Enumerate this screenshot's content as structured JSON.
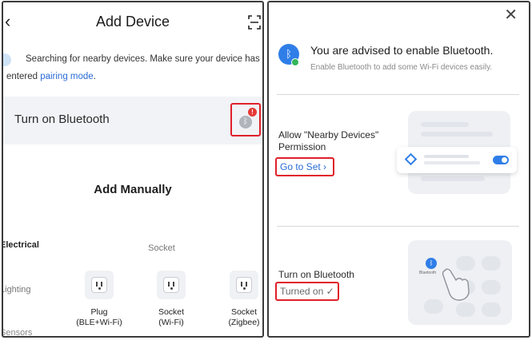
{
  "left": {
    "header": {
      "back_icon": "chevron-left-icon",
      "title": "Add Device",
      "scan_icon": "scan-frame-icon"
    },
    "search": {
      "text_before": "Searching for nearby devices. Make sure your device has entered ",
      "link": "pairing mode",
      "text_after": "."
    },
    "bluetooth_row": {
      "label": "Turn on Bluetooth",
      "icon": "bluetooth-icon",
      "alert": "!",
      "alert_color": "#e53935"
    },
    "manual_title": "Add Manually",
    "categories": [
      "Electrical",
      "Lighting",
      "Sensors"
    ],
    "section_title": "Socket",
    "devices": [
      {
        "line1": "Plug",
        "line2": "(BLE+Wi-Fi)"
      },
      {
        "line1": "Socket",
        "line2": "(Wi-Fi)"
      },
      {
        "line1": "Socket",
        "line2": "(Zigbee)"
      }
    ]
  },
  "right": {
    "close_icon": "close-icon",
    "title": "You are advised to enable Bluetooth.",
    "subtitle": "Enable Bluetooth to add some Wi-Fi devices easily.",
    "permission": {
      "label": "Allow \"Nearby Devices\" Permission",
      "action": "Go to Set ›"
    },
    "bluetooth": {
      "label": "Turn on Bluetooth",
      "status": "Turned on ✓",
      "illustration_label": "Bluetooth"
    },
    "accent_color": "#2f7ee8",
    "highlight_color": "#e0202a"
  }
}
